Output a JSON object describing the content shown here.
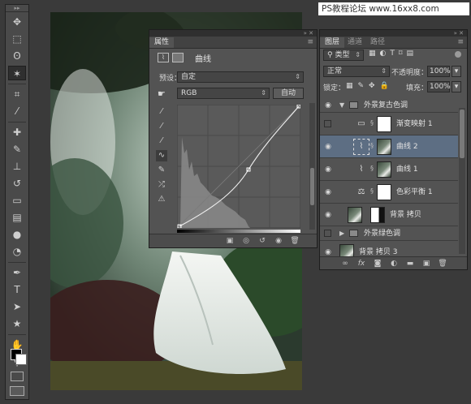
{
  "watermark": "PS教程论坛 www.16xx8.com",
  "colors": {
    "panel_bg": "#535353",
    "selected_layer": "#5d6e83",
    "foreground": "#000000",
    "background": "#ffffff"
  },
  "toolbar": {
    "tools": [
      {
        "name": "move-tool-icon",
        "glyph": "✥"
      },
      {
        "name": "marquee-tool-icon",
        "glyph": "⬚"
      },
      {
        "name": "lasso-tool-icon",
        "glyph": "ʘ"
      },
      {
        "name": "magic-wand-tool-icon",
        "glyph": "✶",
        "active": true
      },
      {
        "name": "crop-tool-icon",
        "glyph": "⌗"
      },
      {
        "name": "eyedropper-tool-icon",
        "glyph": "⁄"
      },
      {
        "name": "healing-brush-tool-icon",
        "glyph": "✚"
      },
      {
        "name": "brush-tool-icon",
        "glyph": "✎"
      },
      {
        "name": "clone-stamp-tool-icon",
        "glyph": "⊥"
      },
      {
        "name": "history-brush-tool-icon",
        "glyph": "↺"
      },
      {
        "name": "eraser-tool-icon",
        "glyph": "▭"
      },
      {
        "name": "gradient-tool-icon",
        "glyph": "▤"
      },
      {
        "name": "blur-tool-icon",
        "glyph": "●"
      },
      {
        "name": "dodge-tool-icon",
        "glyph": "◔"
      },
      {
        "name": "pen-tool-icon",
        "glyph": "✒"
      },
      {
        "name": "type-tool-icon",
        "glyph": "T"
      },
      {
        "name": "path-selection-tool-icon",
        "glyph": "➤"
      },
      {
        "name": "shape-tool-icon",
        "glyph": "★"
      },
      {
        "name": "hand-tool-icon",
        "glyph": "✋"
      },
      {
        "name": "zoom-tool-icon",
        "glyph": "⚲"
      }
    ]
  },
  "properties": {
    "tabs": [
      "属性"
    ],
    "title": "曲线",
    "preset_label": "预设：",
    "preset_value": "自定",
    "channel_value": "RGB",
    "auto_button": "自动"
  },
  "layers": {
    "tabs": [
      "图层",
      "通道",
      "路径"
    ],
    "filter_kind": "类型",
    "blend_mode": "正常",
    "opacity_label": "不透明度：",
    "opacity_value": "100%",
    "lock_label": "锁定：",
    "fill_label": "填充：",
    "fill_value": "100%",
    "items": [
      {
        "type": "group",
        "name": "外景复古色调",
        "visible": true,
        "expanded": true
      },
      {
        "type": "adjust",
        "name": "渐变映射 1",
        "visible": false,
        "icon": "gradient-map-icon",
        "glyph": "▭",
        "mask": "white",
        "indent": true
      },
      {
        "type": "adjust",
        "name": "曲线 2",
        "visible": true,
        "icon": "curves-icon",
        "glyph": "⌇",
        "mask": "photo",
        "indent": true,
        "selected": true
      },
      {
        "type": "adjust",
        "name": "曲线 1",
        "visible": true,
        "icon": "curves-icon",
        "glyph": "⌇",
        "mask": "photo",
        "indent": true
      },
      {
        "type": "adjust",
        "name": "色彩平衡 1",
        "visible": true,
        "icon": "color-balance-icon",
        "glyph": "⚖",
        "mask": "white",
        "indent": true
      },
      {
        "type": "pixel",
        "name": "背景 拷贝",
        "visible": true
      },
      {
        "type": "group",
        "name": "外景绿色调",
        "visible": false,
        "expanded": false
      },
      {
        "type": "pixel",
        "name": "背景 拷贝 3",
        "visible": true
      }
    ]
  }
}
